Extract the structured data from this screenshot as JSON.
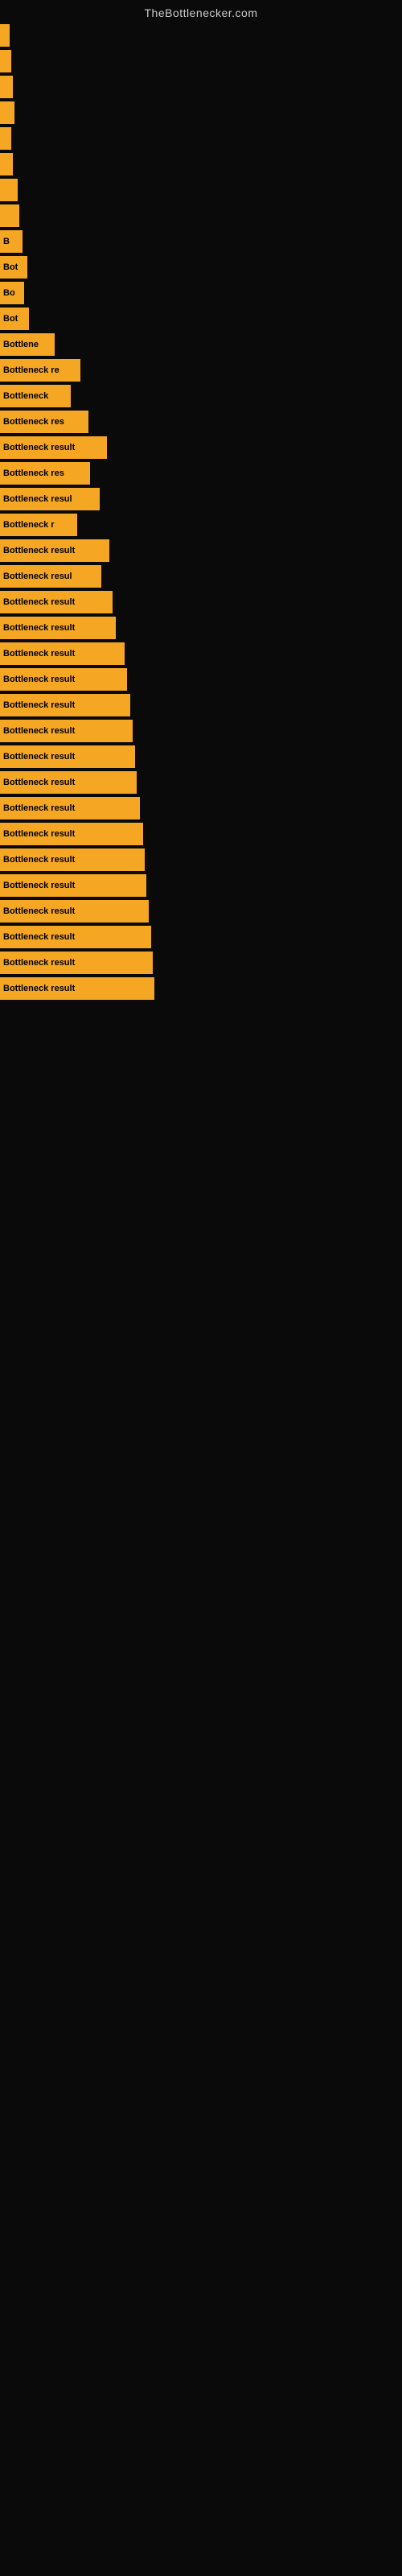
{
  "site": {
    "title": "TheBottlenecker.com"
  },
  "bars": [
    {
      "label": "",
      "width": 12
    },
    {
      "label": "",
      "width": 14
    },
    {
      "label": "",
      "width": 16
    },
    {
      "label": "",
      "width": 18
    },
    {
      "label": "",
      "width": 14
    },
    {
      "label": "",
      "width": 16
    },
    {
      "label": "",
      "width": 22
    },
    {
      "label": "",
      "width": 24
    },
    {
      "label": "B",
      "width": 28
    },
    {
      "label": "Bot",
      "width": 34
    },
    {
      "label": "Bo",
      "width": 30
    },
    {
      "label": "Bot",
      "width": 36
    },
    {
      "label": "Bottlene",
      "width": 68
    },
    {
      "label": "Bottleneck re",
      "width": 100
    },
    {
      "label": "Bottleneck",
      "width": 88
    },
    {
      "label": "Bottleneck res",
      "width": 110
    },
    {
      "label": "Bottleneck result",
      "width": 133
    },
    {
      "label": "Bottleneck res",
      "width": 112
    },
    {
      "label": "Bottleneck resul",
      "width": 124
    },
    {
      "label": "Bottleneck r",
      "width": 96
    },
    {
      "label": "Bottleneck result",
      "width": 136
    },
    {
      "label": "Bottleneck resul",
      "width": 126
    },
    {
      "label": "Bottleneck result",
      "width": 140
    },
    {
      "label": "Bottleneck result",
      "width": 144
    },
    {
      "label": "Bottleneck result",
      "width": 155
    },
    {
      "label": "Bottleneck result",
      "width": 158
    },
    {
      "label": "Bottleneck result",
      "width": 162
    },
    {
      "label": "Bottleneck result",
      "width": 165
    },
    {
      "label": "Bottleneck result",
      "width": 168
    },
    {
      "label": "Bottleneck result",
      "width": 170
    },
    {
      "label": "Bottleneck result",
      "width": 174
    },
    {
      "label": "Bottleneck result",
      "width": 178
    },
    {
      "label": "Bottleneck result",
      "width": 180
    },
    {
      "label": "Bottleneck result",
      "width": 182
    },
    {
      "label": "Bottleneck result",
      "width": 185
    },
    {
      "label": "Bottleneck result",
      "width": 188
    },
    {
      "label": "Bottleneck result",
      "width": 190
    },
    {
      "label": "Bottleneck result",
      "width": 192
    }
  ]
}
